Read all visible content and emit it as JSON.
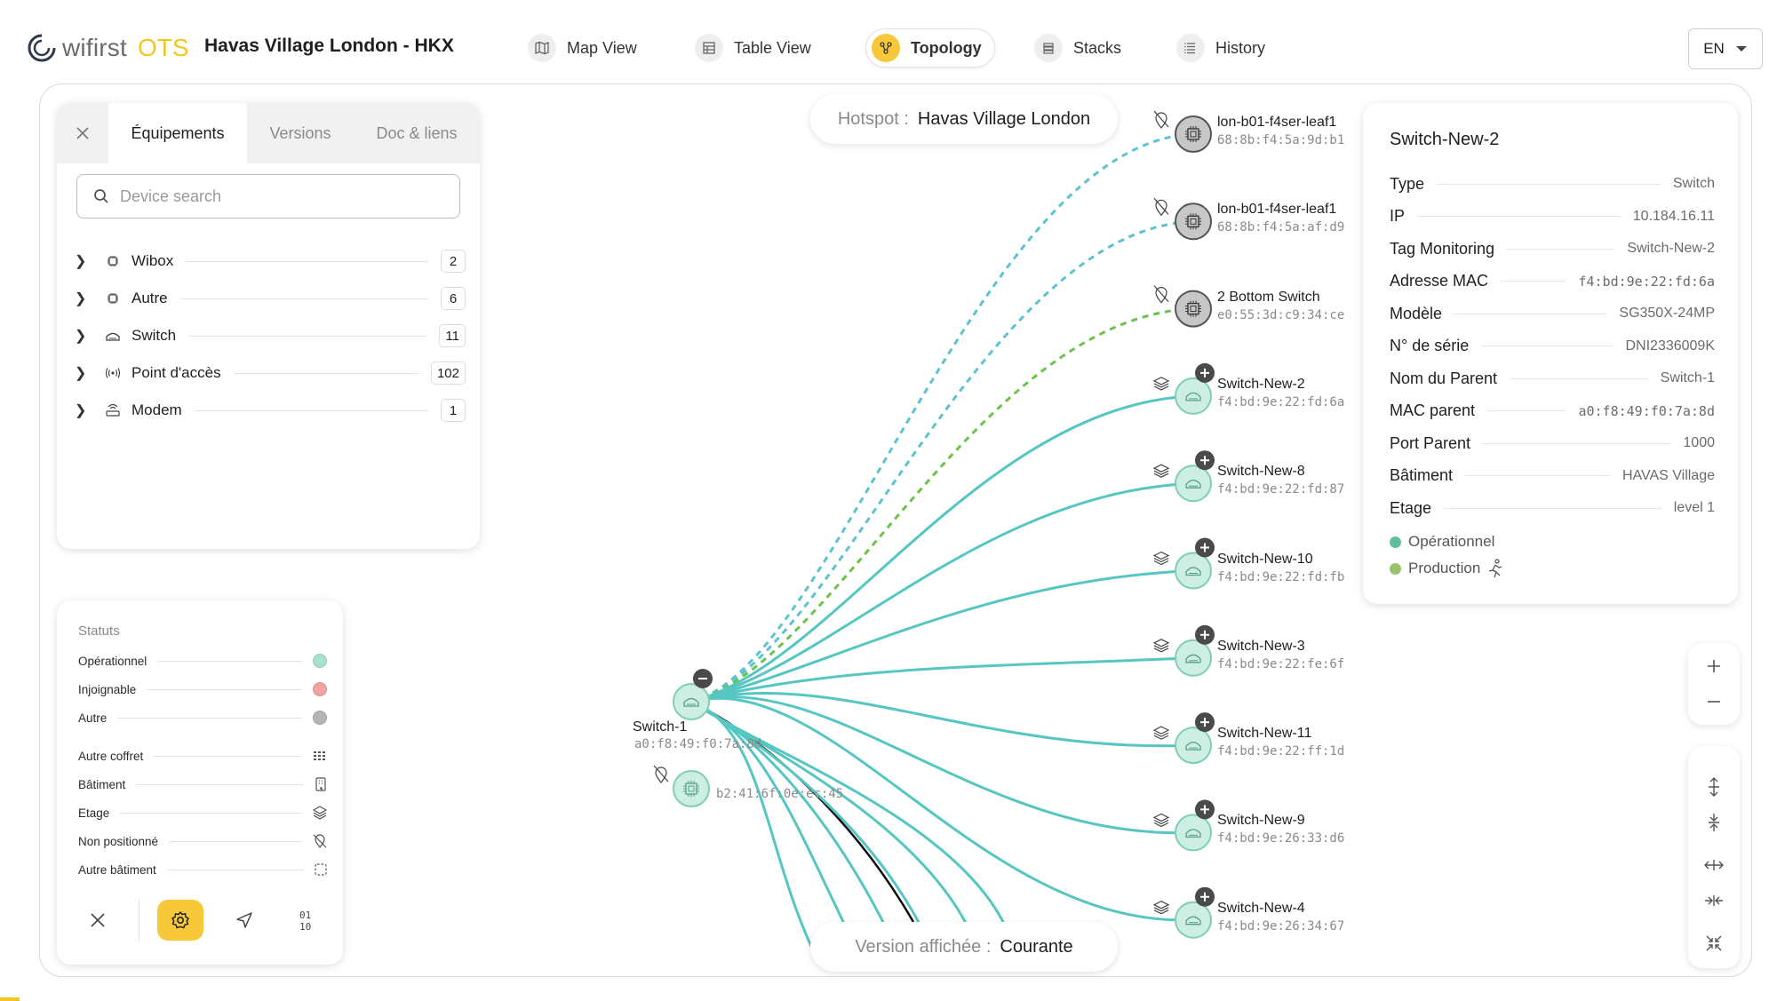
{
  "app": {
    "logo_text": "wifirst",
    "logo_suffix": "OTS",
    "site_title": "Havas Village London - HKX"
  },
  "nav": [
    {
      "label": "Map View",
      "icon": "map-icon"
    },
    {
      "label": "Table View",
      "icon": "table-icon"
    },
    {
      "label": "Topology",
      "icon": "topology-icon",
      "active": true
    },
    {
      "label": "Stacks",
      "icon": "stacks-icon"
    },
    {
      "label": "History",
      "icon": "history-icon"
    }
  ],
  "lang": "EN",
  "equipment_panel": {
    "tabs": [
      "Équipements",
      "Versions",
      "Doc & liens"
    ],
    "search_placeholder": "Device search",
    "categories": [
      {
        "label": "Wibox",
        "count": "2",
        "icon": "chip-icon"
      },
      {
        "label": "Autre",
        "count": "6",
        "icon": "chip-icon"
      },
      {
        "label": "Switch",
        "count": "11",
        "icon": "switch-icon"
      },
      {
        "label": "Point d'accès",
        "count": "102",
        "icon": "access-point-icon"
      },
      {
        "label": "Modem",
        "count": "1",
        "icon": "modem-icon"
      }
    ]
  },
  "status_legend": {
    "title": "Statuts",
    "statuses": [
      {
        "label": "Opérationnel",
        "color": "#a8e0cc"
      },
      {
        "label": "Injoignable",
        "color": "#f0a3a3"
      },
      {
        "label": "Autre",
        "color": "#b5b5b5"
      }
    ],
    "markers": [
      {
        "label": "Autre coffret",
        "icon": "grid-dots-icon"
      },
      {
        "label": "Bâtiment",
        "icon": "building-icon"
      },
      {
        "label": "Etage",
        "icon": "layers-icon"
      },
      {
        "label": "Non positionné",
        "icon": "no-location-icon"
      },
      {
        "label": "Autre bâtiment",
        "icon": "dashed-square-icon"
      }
    ]
  },
  "hotspot": {
    "key": "Hotspot :",
    "value": "Havas Village London"
  },
  "version": {
    "key": "Version affichée :",
    "value": "Courante"
  },
  "graph": {
    "root": {
      "name": "Switch-1",
      "mac": "a0:f8:49:f0:7a:8d"
    },
    "orphan": {
      "mac": "b2:41:6f:0e:ec:45"
    },
    "children": [
      {
        "name": "lon-b01-f4ser-leaf1",
        "mac": "68:8b:f4:5a:9d:b1",
        "kind": "chip",
        "link": "dashed-blue"
      },
      {
        "name": "lon-b01-f4ser-leaf1",
        "mac": "68:8b:f4:5a:af:d9",
        "kind": "chip",
        "link": "dashed-blue"
      },
      {
        "name": "2 Bottom Switch",
        "mac": "e0:55:3d:c9:34:ce",
        "kind": "chip",
        "link": "dashed-green"
      },
      {
        "name": "Switch-New-2",
        "mac": "f4:bd:9e:22:fd:6a",
        "kind": "switch",
        "link": "solid"
      },
      {
        "name": "Switch-New-8",
        "mac": "f4:bd:9e:22:fd:87",
        "kind": "switch",
        "link": "solid"
      },
      {
        "name": "Switch-New-10",
        "mac": "f4:bd:9e:22:fd:fb",
        "kind": "switch",
        "link": "solid"
      },
      {
        "name": "Switch-New-3",
        "mac": "f4:bd:9e:22:fe:6f",
        "kind": "switch",
        "link": "solid"
      },
      {
        "name": "Switch-New-11",
        "mac": "f4:bd:9e:22:ff:1d",
        "kind": "switch",
        "link": "solid"
      },
      {
        "name": "Switch-New-9",
        "mac": "f4:bd:9e:26:33:d6",
        "kind": "switch",
        "link": "solid"
      },
      {
        "name": "Switch-New-4",
        "mac": "f4:bd:9e:26:34:67",
        "kind": "switch",
        "link": "solid"
      }
    ]
  },
  "details": {
    "title": "Switch-New-2",
    "rows": [
      {
        "key": "Type",
        "value": "Switch"
      },
      {
        "key": "IP",
        "value": "10.184.16.11"
      },
      {
        "key": "Tag Monitoring",
        "value": "Switch-New-2"
      },
      {
        "key": "Adresse MAC",
        "value": "f4:bd:9e:22:fd:6a",
        "mono": true
      },
      {
        "key": "Modèle",
        "value": "SG350X-24MP"
      },
      {
        "key": "N° de série",
        "value": "DNI2336009K"
      },
      {
        "key": "Nom du Parent",
        "value": "Switch-1"
      },
      {
        "key": "MAC parent",
        "value": "a0:f8:49:f0:7a:8d",
        "mono": true
      },
      {
        "key": "Port Parent",
        "value": "1000"
      },
      {
        "key": "Bâtiment",
        "value": "HAVAS Village"
      },
      {
        "key": "Etage",
        "value": "level 1"
      }
    ],
    "statuses": [
      {
        "label": "Opérationnel",
        "color": "#5fbf9a"
      },
      {
        "label": "Production",
        "color": "#9ac26a"
      }
    ]
  },
  "colors": {
    "accent": "#f7c93a",
    "link_solid": "#56c6c2",
    "link_dashed_blue": "#5cc3cf",
    "link_dashed_green": "#6cc24a",
    "node_fill": "#cdeee2",
    "node_stroke": "#7fcfb3",
    "chip_fill": "#c7c7c7"
  }
}
